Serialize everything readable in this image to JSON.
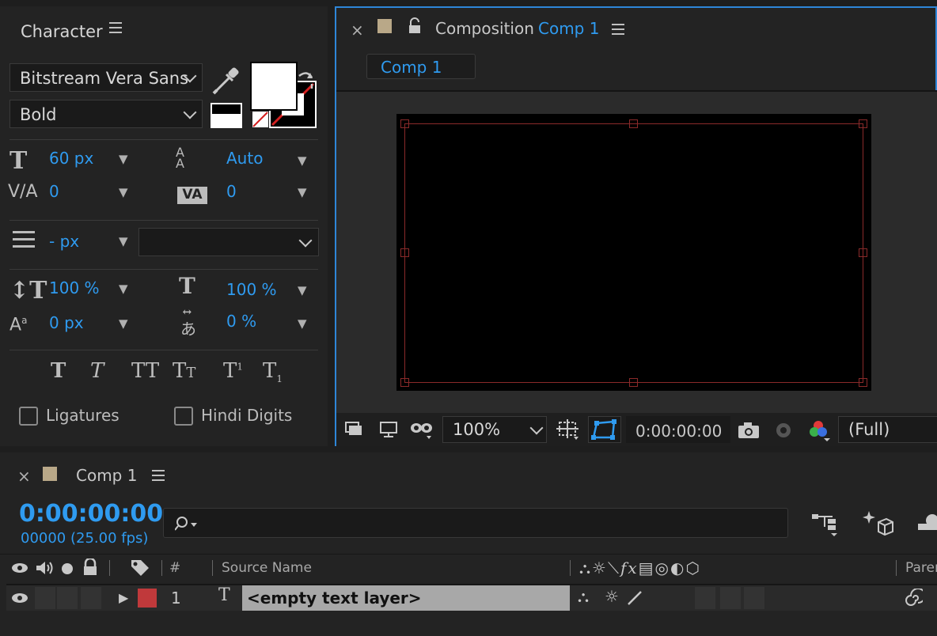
{
  "character": {
    "title": "Character",
    "font_family": "Bitstream Vera Sans",
    "font_style": "Bold",
    "font_size": "60 px",
    "leading": "Auto",
    "kerning": "0",
    "tracking": "0",
    "stroke_width": "- px",
    "stroke_type": "",
    "vertical_scale": "100 %",
    "horizontal_scale": "100 %",
    "baseline_shift": "0 px",
    "tsume": "0 %",
    "ligatures_label": "Ligatures",
    "hindi_digits_label": "Hindi Digits",
    "fill_color": "#ffffff",
    "stroke_color": "#000000"
  },
  "composition": {
    "panel_label": "Composition",
    "comp_name": "Comp 1",
    "tab_label": "Comp 1",
    "zoom": "100%",
    "timecode": "0:00:00:00",
    "resolution": "(Full)"
  },
  "timeline": {
    "comp_name": "Comp 1",
    "timecode": "0:00:00:00",
    "frame_info": "00000 (25.00 fps)",
    "col_number": "#",
    "col_source_name": "Source Name",
    "col_parent": "Parer",
    "layer": {
      "number": "1",
      "type_glyph": "T",
      "name": "<empty text layer>",
      "label_color": "#c0393b"
    }
  },
  "colors": {
    "accent": "#2f9bf0",
    "panel_bg": "#232323",
    "comp_swatch": "#b9a888",
    "focus_border": "#2e86d8"
  }
}
